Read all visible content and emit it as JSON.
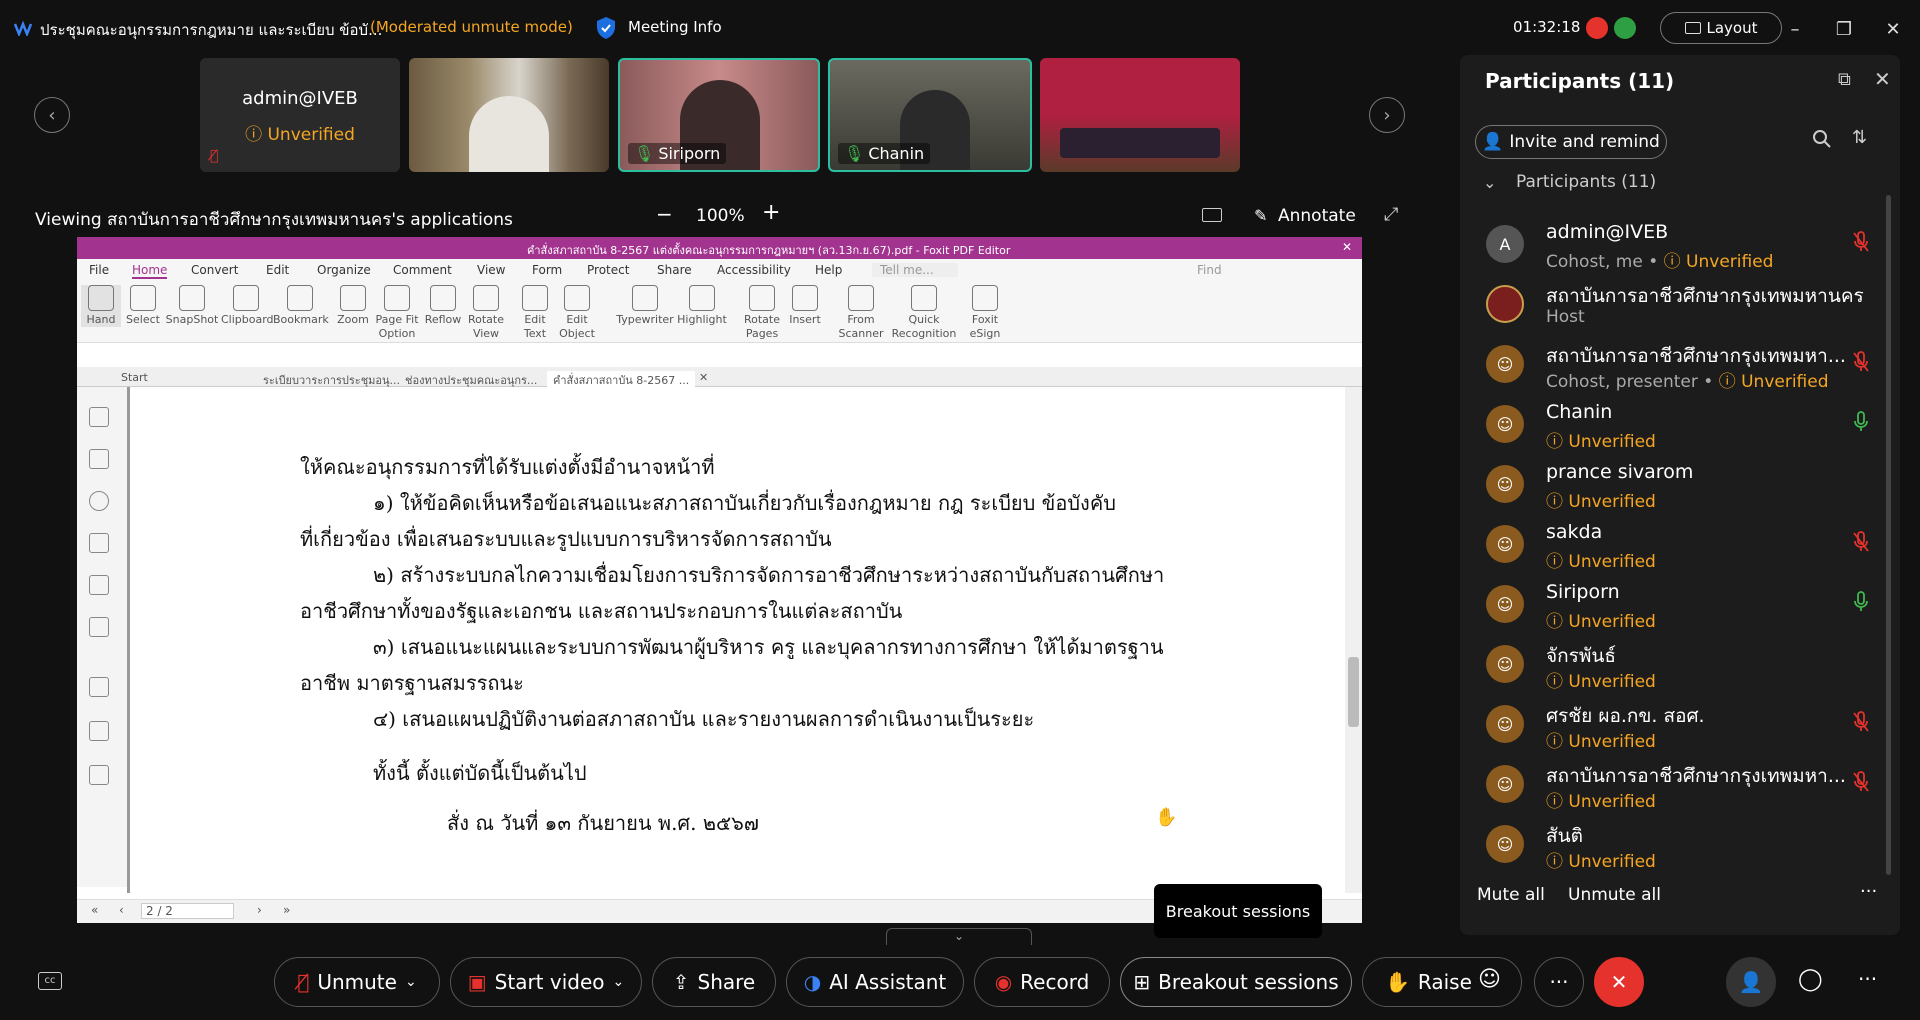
{
  "titlebar": {
    "meeting_title": "ประชุมคณะอนุกรรมการกฎหมาย และระเบียบ ข้อบั...",
    "mode": "(Moderated unmute mode)",
    "meeting_info": "Meeting Info",
    "timer": "01:32:18",
    "layout": "Layout"
  },
  "thumbnails": [
    {
      "name": "admin@IVEB",
      "status": "Unverified"
    },
    {
      "name": ""
    },
    {
      "name": "Siriporn"
    },
    {
      "name": "Chanin"
    },
    {
      "name": ""
    }
  ],
  "share": {
    "viewing": "Viewing สถาบันการอาชีวศึกษากรุงเทพมหานคร's applications",
    "zoom": "100%",
    "minus": "−",
    "plus": "+",
    "annotate": "Annotate"
  },
  "pdf": {
    "window_title": "คำสั่งสภาสถาบัน 8-2567 แต่งตั้งคณะอนุกรรมการกฎหมายฯ (ลว.13ก.ย.67).pdf - Foxit PDF Editor",
    "menus": [
      "File",
      "Home",
      "Convert",
      "Edit",
      "Organize",
      "Comment",
      "View",
      "Form",
      "Protect",
      "Share",
      "Accessibility",
      "Help"
    ],
    "tell_me": "Tell me...",
    "find": "Find",
    "ribbon": [
      {
        "l1": "Hand",
        "l2": ""
      },
      {
        "l1": "Select",
        "l2": ""
      },
      {
        "l1": "SnapShot",
        "l2": ""
      },
      {
        "l1": "Clipboard",
        "l2": ""
      },
      {
        "l1": "Bookmark",
        "l2": ""
      },
      {
        "l1": "Zoom",
        "l2": ""
      },
      {
        "l1": "Page Fit",
        "l2": "Option"
      },
      {
        "l1": "Reflow",
        "l2": ""
      },
      {
        "l1": "Rotate",
        "l2": "View"
      },
      {
        "l1": "Edit",
        "l2": "Text"
      },
      {
        "l1": "Edit",
        "l2": "Object"
      },
      {
        "l1": "Typewriter",
        "l2": ""
      },
      {
        "l1": "Highlight",
        "l2": ""
      },
      {
        "l1": "Rotate",
        "l2": "Pages"
      },
      {
        "l1": "Insert",
        "l2": ""
      },
      {
        "l1": "From",
        "l2": "Scanner"
      },
      {
        "l1": "Quick",
        "l2": "Recognition"
      },
      {
        "l1": "Foxit",
        "l2": "eSign"
      }
    ],
    "tabs": [
      "Start",
      "ระเบียบวาระการประชุมอนุ...",
      "ช่องทางประชุมคณะอนุกร...",
      "คำสั่งสภาสถาบัน 8-2567 ..."
    ],
    "lines": [
      "ให้คณะอนุกรรมการที่ได้รับแต่งตั้งมีอำนาจหน้าที่",
      "๑) ให้ข้อคิดเห็นหรือข้อเสนอแนะสภาสถาบันเกี่ยวกับเรื่องกฎหมาย กฎ ระเบียบ ข้อบังคับ",
      "ที่เกี่ยวข้อง เพื่อเสนอระบบและรูปแบบการบริหารจัดการสถาบัน",
      "๒) สร้างระบบกลไกความเชื่อมโยงการบริการจัดการอาชีวศึกษาระหว่างสถาบันกับสถานศึกษา",
      "อาชีวศึกษาทั้งของรัฐและเอกชน และสถานประกอบการในแต่ละสถาบัน",
      "๓) เสนอแนะแผนและระบบการพัฒนาผู้บริหาร ครู และบุคลากรทางการศึกษา ให้ได้มาตรฐาน",
      "อาชีพ มาตรฐานสมรรถนะ",
      "๔) เสนอแผนปฏิบัติงานต่อสภาสถาบัน และรายงานผลการดำเนินงานเป็นระยะ",
      "ทั้งนี้ ตั้งแต่บัดนี้เป็นต้นไป",
      "สั่ง ณ วันที่  ๑๓  กันยายน พ.ศ. ๒๕๖๗"
    ],
    "page_indicator": "2 / 2"
  },
  "participants": {
    "title": "Participants (11)",
    "invite": "Invite and remind",
    "section": "Participants (11)",
    "list": [
      {
        "name": "admin@IVEB",
        "role": "Cohost, me",
        "status": "Unverified",
        "avatar": "A",
        "mic": "muted"
      },
      {
        "name": "สถาบันการอาชีวศึกษากรุงเทพมหานคร",
        "role": "Host",
        "status": "",
        "avatar": "",
        "mic": "none"
      },
      {
        "name": "สถาบันการอาชีวศึกษากรุงเทพมหา...",
        "role": "Cohost, presenter",
        "status": "Unverified",
        "avatar": "",
        "mic": "muted"
      },
      {
        "name": "Chanin",
        "role": "",
        "status": "Unverified",
        "avatar": "",
        "mic": "on"
      },
      {
        "name": "prance sivarom",
        "role": "",
        "status": "Unverified",
        "avatar": "",
        "mic": "none"
      },
      {
        "name": "sakda",
        "role": "",
        "status": "Unverified",
        "avatar": "",
        "mic": "muted"
      },
      {
        "name": "Siriporn",
        "role": "",
        "status": "Unverified",
        "avatar": "",
        "mic": "on"
      },
      {
        "name": "จักรพันธ์",
        "role": "",
        "status": "Unverified",
        "avatar": "",
        "mic": "none"
      },
      {
        "name": "ศรชัย ผอ.กข. สอศ.",
        "role": "",
        "status": "Unverified",
        "avatar": "",
        "mic": "muted"
      },
      {
        "name": "สถาบันการอาชีวศึกษากรุงเทพมหา...",
        "role": "",
        "status": "Unverified",
        "avatar": "",
        "mic": "muted"
      },
      {
        "name": "สันติ",
        "role": "",
        "status": "Unverified",
        "avatar": "",
        "mic": "none"
      }
    ],
    "mute_all": "Mute all",
    "unmute_all": "Unmute all"
  },
  "bottombar": {
    "unmute": "Unmute",
    "start_video": "Start video",
    "share": "Share",
    "ai_assistant": "AI Assistant",
    "record": "Record",
    "breakout": "Breakout sessions",
    "raise": "Raise",
    "more": "···",
    "end": "✕"
  },
  "tooltip": "Breakout sessions",
  "colors": {
    "accent": "#f5a623",
    "danger": "#e5322d",
    "mic_on": "#3fb950",
    "brand_pdf": "#a2338f"
  }
}
